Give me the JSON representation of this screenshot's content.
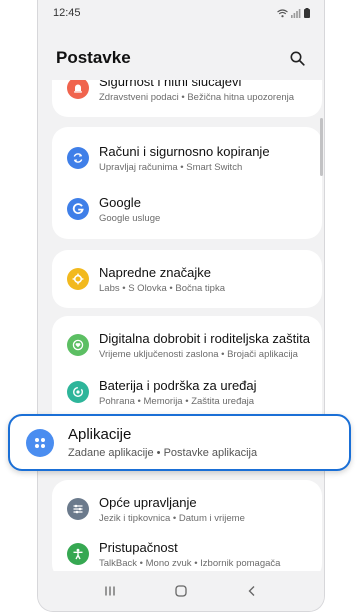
{
  "status_bar": {
    "time": "12:45"
  },
  "header": {
    "title": "Postavke"
  },
  "items": {
    "safety": {
      "title": "Sigurnost i hitni slučajevi",
      "subtitle": "Zdravstveni podaci  •  Bežična hitna upozorenja",
      "color": "#f0644e"
    },
    "accounts": {
      "title": "Računi i sigurnosno kopiranje",
      "subtitle": "Upravljaj računima  •  Smart Switch",
      "color": "#3f7fe8"
    },
    "google": {
      "title": "Google",
      "subtitle": "Google usluge",
      "color": "#3f7fe8"
    },
    "advanced": {
      "title": "Napredne značajke",
      "subtitle": "Labs  •  S Olovka  •  Bočna tipka",
      "color": "#f2b91e"
    },
    "wellbeing": {
      "title": "Digitalna dobrobit i roditeljska zaštita",
      "subtitle": "Vrijeme uključenosti zaslona  •  Brojači aplikacija",
      "color": "#5cbf63"
    },
    "battery": {
      "title": "Baterija i podrška za uređaj",
      "subtitle": "Pohrana  •  Memorija  •  Zaštita uređaja",
      "color": "#2eb59a"
    },
    "apps": {
      "title": "Aplikacije",
      "subtitle": "Zadane aplikacije  •  Postavke aplikacija",
      "color": "#4a8df0"
    },
    "general": {
      "title": "Opće upravljanje",
      "subtitle": "Jezik i tipkovnica  •  Datum i vrijeme",
      "color": "#6b7a8c"
    },
    "accessibility": {
      "title": "Pristupačnost",
      "subtitle": "TalkBack  •  Mono zvuk  •  Izbornik pomagača",
      "color": "#36a852"
    }
  },
  "icons": {
    "search": "search-icon",
    "safety": "alert-icon",
    "accounts": "sync-icon",
    "google": "google-icon",
    "advanced": "gear-plus-icon",
    "wellbeing": "heart-icon",
    "battery": "battery-care-icon",
    "apps": "apps-grid-icon",
    "general": "sliders-icon",
    "accessibility": "person-icon"
  },
  "highlight_color": "#1a6fd6"
}
